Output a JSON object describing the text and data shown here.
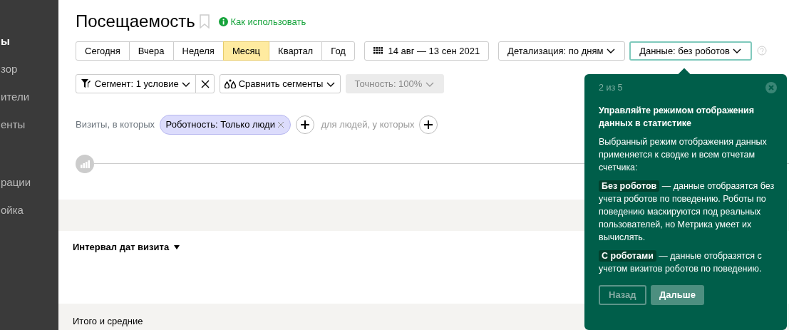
{
  "sidebar": {
    "items": [
      {
        "label": "ы",
        "selected": true
      },
      {
        "label": "зор",
        "selected": false
      },
      {
        "label": "ители",
        "selected": false
      },
      {
        "label": "енты",
        "selected": false
      },
      {
        "label": "рации",
        "selected": false
      },
      {
        "label": "ойка",
        "selected": false
      }
    ]
  },
  "header": {
    "title": "Посещаемость",
    "help_link": "Как использовать"
  },
  "periods": [
    {
      "label": "Сегодня",
      "selected": false
    },
    {
      "label": "Вчера",
      "selected": false
    },
    {
      "label": "Неделя",
      "selected": false
    },
    {
      "label": "Месяц",
      "selected": true
    },
    {
      "label": "Квартал",
      "selected": false
    },
    {
      "label": "Год",
      "selected": false
    }
  ],
  "date_range": "14 авг — 13 сен 2021",
  "dropdowns": [
    {
      "label": "Детализация: по дням",
      "focused": false
    },
    {
      "label": "Данные: без роботов",
      "focused": true
    }
  ],
  "segment": {
    "label": "Сегмент: 1 условие"
  },
  "compare": {
    "label": "Сравнить сегменты"
  },
  "accuracy": {
    "label": "Точность: 100%",
    "disabled": true
  },
  "filter": {
    "prefix": "Визиты, в которых",
    "chip": "Роботность: Только люди",
    "middle": "для людей, у которых"
  },
  "sections": [
    {
      "label": "Интервал дат визита"
    },
    {
      "label": "Итого и средние"
    }
  ],
  "popover": {
    "step": "2 из 5",
    "title": "Управляйте режимом отображения данных в статистике",
    "intro": "Выбранный режим отображения данных применяется к сводке и всем отчетам счетчика:",
    "items": [
      {
        "tag": "Без роботов",
        "text": "— данные отобразятся без учета роботов по поведению. Роботы по поведению маскируются под реальных пользователей, но Метрика умеет их вычислять."
      },
      {
        "tag": "С роботами",
        "text": "— данные отобразятся с учетом визитов роботов по поведению."
      }
    ],
    "buttons": [
      {
        "label": "Назад",
        "kind": "secondary"
      },
      {
        "label": "Дальше",
        "kind": "primary"
      }
    ]
  }
}
